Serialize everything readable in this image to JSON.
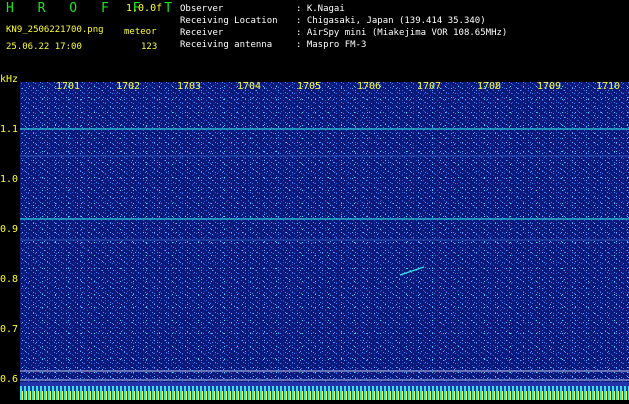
{
  "header": {
    "title": "H R O F F T",
    "version": "1.0.0f",
    "filename": "KN9_2506221700.png",
    "datetime": "25.06.22 17:00",
    "meteor_label": "meteor",
    "meteor_count": "123",
    "info_rows": [
      {
        "label": "Observer",
        "value": ": K.Nagai"
      },
      {
        "label": "Receiving Location",
        "value": ": Chigasaki, Japan (139.414 35.340)"
      },
      {
        "label": "Receiver",
        "value": ": AirSpy mini (Miakejima VOR 108.65MHz)"
      },
      {
        "label": "Receiving antenna",
        "value": ": Maspro FM-3"
      }
    ]
  },
  "axes": {
    "y_unit": "kHz",
    "y_ticks": [
      "1.1",
      "1.0",
      "0.9",
      "0.8",
      "0.7",
      "0.6"
    ],
    "x_ticks": [
      "1701",
      "1702",
      "1703",
      "1704",
      "1705",
      "1706",
      "1707",
      "1708",
      "1709",
      "1710"
    ]
  },
  "colors": {
    "background": "#0b1a7a",
    "noise_light": "#3a7bff",
    "signal": "#33e6e6",
    "label": "#ffff33",
    "title": "#19e619"
  }
}
